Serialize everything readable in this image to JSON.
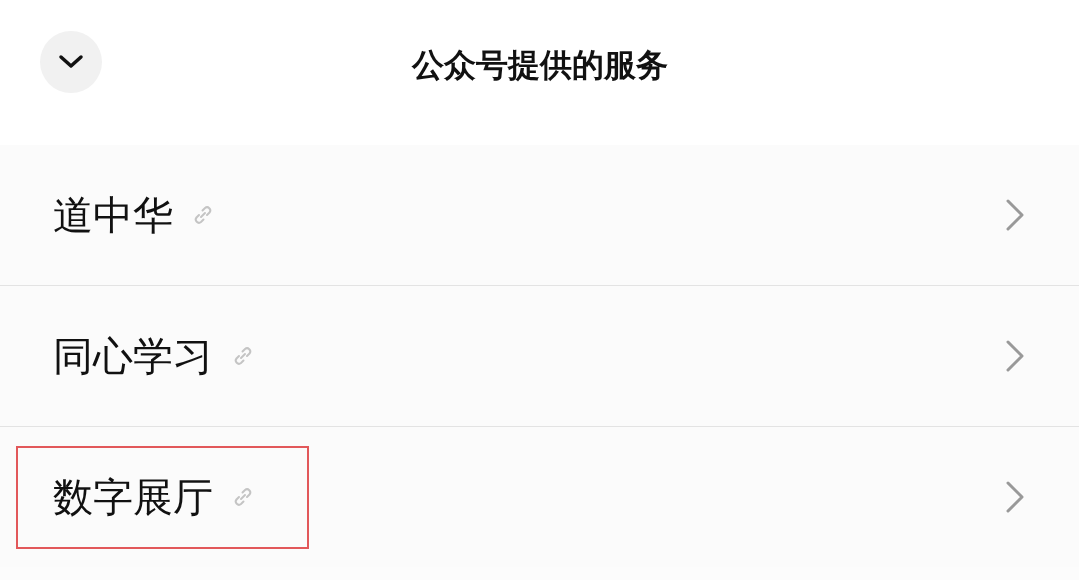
{
  "header": {
    "title": "公众号提供的服务"
  },
  "services": [
    {
      "label": "道中华",
      "highlighted": false
    },
    {
      "label": "同心学习",
      "highlighted": false
    },
    {
      "label": "数字展厅",
      "highlighted": true
    }
  ]
}
